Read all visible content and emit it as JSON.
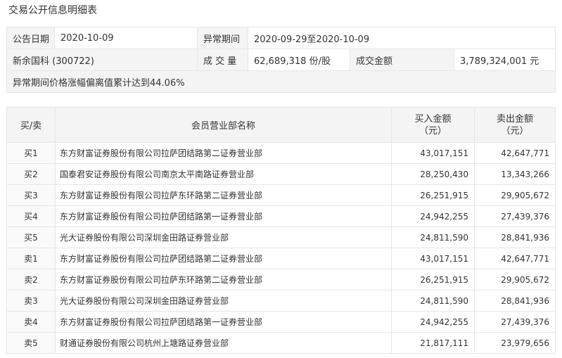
{
  "title": "交易公开信息明细表",
  "info": {
    "announce_date_label": "公告日期",
    "announce_date": "2020-10-09",
    "abnormal_period_label": "异常期间",
    "abnormal_period": "2020-09-29至2020-10-09",
    "stock": "新余国科 (300722)",
    "volume_label": "成 交 量",
    "volume": "62,689,318 份/股",
    "amount_label": "成交金额",
    "amount": "3,789,324,001 元",
    "note": "异常期间价格涨幅偏离值累计达到44.06%"
  },
  "table": {
    "headers": {
      "side": "买/卖",
      "name": "会员营业部名称",
      "buy_line1": "买入金额",
      "buy_line2": "（元）",
      "sell_line1": "卖出金额",
      "sell_line2": "（元）"
    },
    "rows": [
      {
        "side": "买1",
        "name": "东方财富证券股份有限公司拉萨团结路第二证券营业部",
        "buy": "43,017,151",
        "sell": "42,647,771"
      },
      {
        "side": "买2",
        "name": "国泰君安证券股份有限公司南京太平南路证券营业部",
        "buy": "28,250,430",
        "sell": "13,343,266"
      },
      {
        "side": "买3",
        "name": "东方财富证券股份有限公司拉萨东环路第二证券营业部",
        "buy": "26,251,915",
        "sell": "29,905,672"
      },
      {
        "side": "买4",
        "name": "东方财富证券股份有限公司拉萨团结路第一证券营业部",
        "buy": "24,942,255",
        "sell": "27,439,376"
      },
      {
        "side": "买5",
        "name": "光大证券股份有限公司深圳金田路证券营业部",
        "buy": "24,811,590",
        "sell": "28,841,936"
      },
      {
        "side": "卖1",
        "name": "东方财富证券股份有限公司拉萨团结路第二证券营业部",
        "buy": "43,017,151",
        "sell": "42,647,771"
      },
      {
        "side": "卖2",
        "name": "东方财富证券股份有限公司拉萨东环路第二证券营业部",
        "buy": "26,251,915",
        "sell": "29,905,672"
      },
      {
        "side": "卖3",
        "name": "光大证券股份有限公司深圳金田路证券营业部",
        "buy": "24,811,590",
        "sell": "28,841,936"
      },
      {
        "side": "卖4",
        "name": "东方财富证券股份有限公司拉萨团结路第一证券营业部",
        "buy": "24,942,255",
        "sell": "27,439,376"
      },
      {
        "side": "卖5",
        "name": "财通证券股份有限公司杭州上塘路证券营业部",
        "buy": "21,817,111",
        "sell": "23,979,656"
      }
    ]
  }
}
